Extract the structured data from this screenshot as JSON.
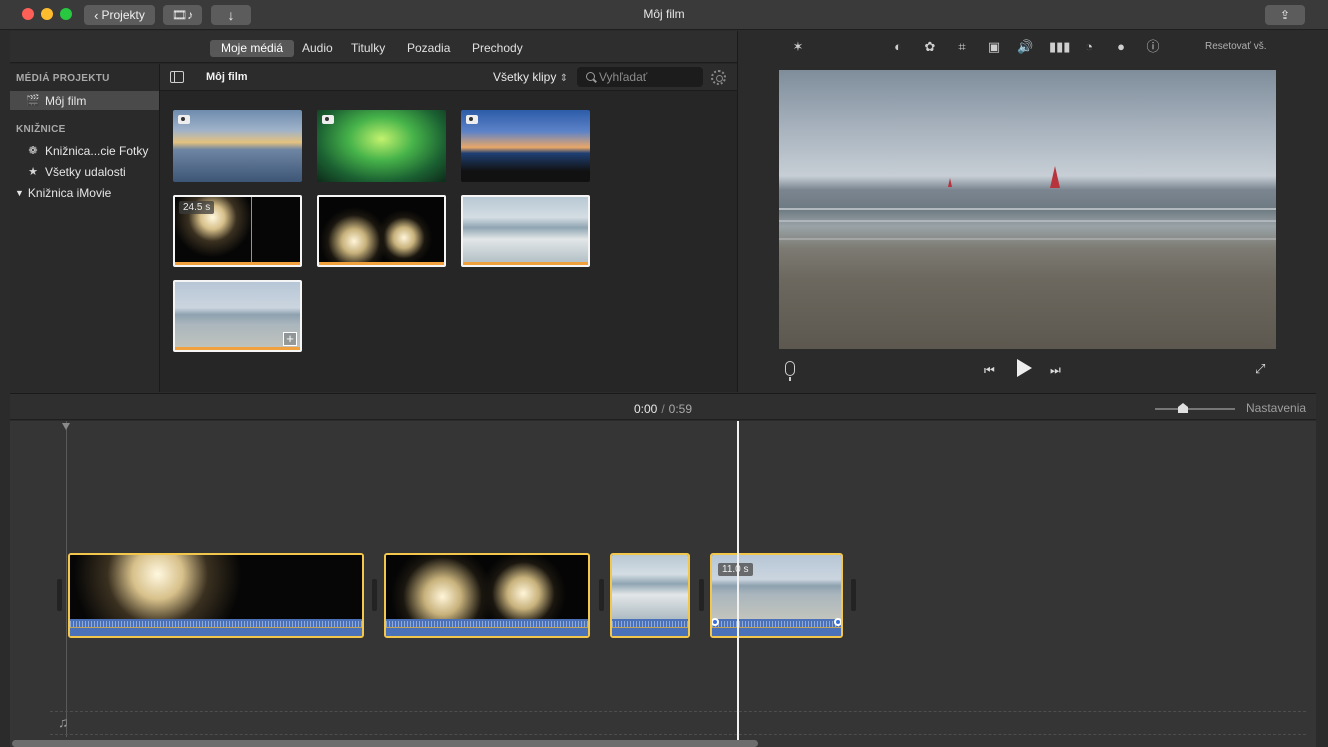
{
  "window": {
    "title": "Môj film",
    "projects_button": "Projekty"
  },
  "media_tabs": [
    {
      "label": "Moje médiá",
      "active": true
    },
    {
      "label": "Audio",
      "active": false
    },
    {
      "label": "Titulky",
      "active": false
    },
    {
      "label": "Pozadia",
      "active": false
    },
    {
      "label": "Prechody",
      "active": false
    }
  ],
  "sidebar": {
    "project_media_header": "MÉDIÁ PROJEKTU",
    "project_item": "Môj film",
    "libraries_header": "KNIŽNICE",
    "library_items": [
      {
        "label": "Knižnica...cie Fotky",
        "icon": "photos-icon"
      },
      {
        "label": "Všetky udalosti",
        "icon": "star-icon"
      }
    ],
    "imovie_library": "Knižnica iMovie"
  },
  "browser": {
    "title": "Môj film",
    "clip_filter": "Všetky klipy",
    "search_placeholder": "Vyhľadať",
    "thumbnails": [
      {
        "kind": "photo",
        "scene": "sunset-sea"
      },
      {
        "kind": "photo",
        "scene": "concert-stage"
      },
      {
        "kind": "photo",
        "scene": "dusk-coast"
      },
      {
        "kind": "video",
        "scene": "fireworks",
        "duration": "24.5 s",
        "selected": true,
        "used_fraction": 1.0
      },
      {
        "kind": "video",
        "scene": "fireworks-pair",
        "used_fraction": 1.0
      },
      {
        "kind": "video",
        "scene": "waves",
        "used_fraction": 1.0
      },
      {
        "kind": "video",
        "scene": "beach-windsurfer",
        "used_fraction": 1.0
      }
    ]
  },
  "viewer": {
    "reset_label": "Resetovať vš.",
    "toolbar_icons": [
      "magic-wand-icon",
      "color-balance-icon",
      "color-palette-icon",
      "crop-icon",
      "stabilization-icon",
      "volume-icon",
      "equalizer-icon",
      "speed-icon",
      "overlay-icon",
      "info-icon"
    ]
  },
  "timeline": {
    "current_time": "0:00",
    "separator": "/",
    "total_time": "0:59",
    "settings_label": "Nastavenia",
    "clips": [
      {
        "scene": "fireworks"
      },
      {
        "scene": "fireworks-pair"
      },
      {
        "scene": "waves"
      },
      {
        "scene": "beach-windsurfer",
        "duration": "11.0 s"
      }
    ]
  }
}
